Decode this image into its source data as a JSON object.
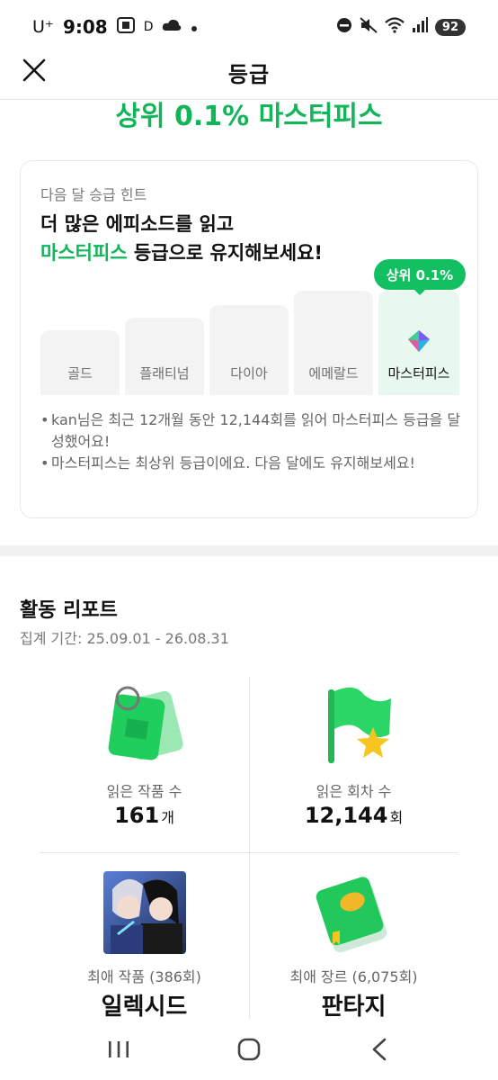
{
  "status_bar": {
    "carrier": "U⁺",
    "time": "9:08",
    "extra": "D",
    "battery": "92"
  },
  "header": {
    "title": "등급"
  },
  "rank": {
    "big_text": "상위 0.1% 마스터피스"
  },
  "hint_card": {
    "label": "다음 달 승급 힌트",
    "title_line1": "더 많은 에피소드를 읽고",
    "title_highlight": "마스터피스",
    "title_line2_rest": " 등급으로 유지해보세요!",
    "tooltip": "상위 0.1%",
    "grades": [
      {
        "name": "골드"
      },
      {
        "name": "플래티넘"
      },
      {
        "name": "다이아"
      },
      {
        "name": "에메랄드"
      },
      {
        "name": "마스터피스"
      }
    ],
    "notes": [
      "kan님은 최근 12개월 동안 12,144회를 읽어 마스터피스 등급을 달성했어요!",
      "마스터피스는 최상위 등급이에요. 다음 달에도 유지해보세요!"
    ]
  },
  "report": {
    "title": "활동 리포트",
    "period": "집계 기간: 25.09.01 - 26.08.31",
    "cells": [
      {
        "label": "읽은 작품 수",
        "value": "161",
        "unit": "개"
      },
      {
        "label": "읽은 회차 수",
        "value": "12,144",
        "unit": "회"
      },
      {
        "label": "최애 작품 (386회)",
        "value": "일렉시드",
        "unit": ""
      },
      {
        "label": "최애 장르 (6,075회)",
        "value": "판타지",
        "unit": ""
      }
    ]
  },
  "colors": {
    "accent": "#12b55a",
    "tooltip": "#12c061"
  },
  "icons": [
    "close-icon",
    "gem-icon",
    "tag-icon",
    "flag-icon",
    "book-icon",
    "recents-icon",
    "home-icon",
    "back-icon"
  ]
}
